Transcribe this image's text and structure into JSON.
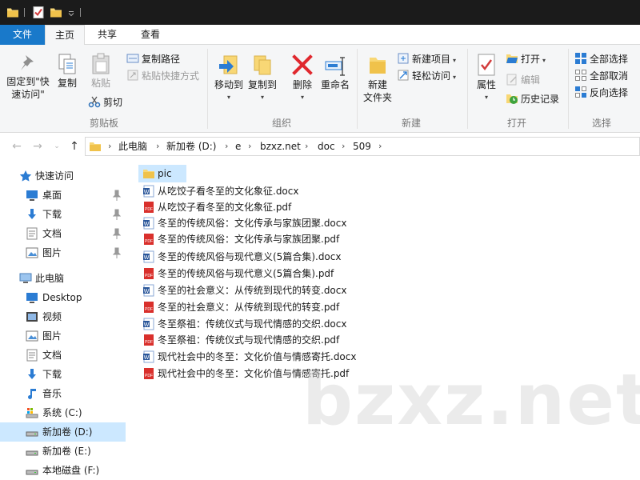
{
  "window": {
    "quick_access_icons": [
      "folder-icon",
      "properties-check-icon",
      "new-folder-icon",
      "customize-dropdown-icon"
    ]
  },
  "ribbon_tabs": {
    "file": "文件",
    "home": "主页",
    "share": "共享",
    "view": "查看"
  },
  "ribbon": {
    "clipboard": {
      "pin_label_1": "固定到\"快",
      "pin_label_2": "速访问\"",
      "copy": "复制",
      "paste": "粘贴",
      "copy_path": "复制路径",
      "paste_shortcut": "粘贴快捷方式",
      "cut": "剪切",
      "group_label": "剪贴板"
    },
    "organize": {
      "move_to": "移动到",
      "copy_to": "复制到",
      "delete": "删除",
      "rename": "重命名",
      "group_label": "组织"
    },
    "new": {
      "new_folder_1": "新建",
      "new_folder_2": "文件夹",
      "new_item": "新建项目",
      "easy_access": "轻松访问",
      "group_label": "新建"
    },
    "open": {
      "properties": "属性",
      "open": "打开",
      "edit": "编辑",
      "history": "历史记录",
      "group_label": "打开"
    },
    "select": {
      "select_all": "全部选择",
      "select_none": "全部取消",
      "invert": "反向选择",
      "group_label": "选择"
    }
  },
  "address": {
    "crumbs": [
      "此电脑",
      "新加卷 (D:)",
      "e",
      "bzxz.net",
      "doc",
      "509"
    ]
  },
  "nav_pane": {
    "quick_access": "快速访问",
    "desktop_pinned": "桌面",
    "downloads_pinned": "下载",
    "documents_pinned": "文档",
    "pictures_pinned": "图片",
    "this_pc": "此电脑",
    "desktop": "Desktop",
    "videos": "视频",
    "pictures": "图片",
    "documents": "文档",
    "downloads": "下载",
    "music": "音乐",
    "drive_c": "系统 (C:)",
    "drive_d": "新加卷 (D:)",
    "drive_e": "新加卷 (E:)",
    "drive_f": "本地磁盘 (F:)"
  },
  "files": [
    {
      "name": "pic",
      "type": "folder"
    },
    {
      "name": "从吃饺子看冬至的文化象征.docx",
      "type": "docx"
    },
    {
      "name": "从吃饺子看冬至的文化象征.pdf",
      "type": "pdf"
    },
    {
      "name": "冬至的传统风俗：文化传承与家族团聚.docx",
      "type": "docx"
    },
    {
      "name": "冬至的传统风俗：文化传承与家族团聚.pdf",
      "type": "pdf"
    },
    {
      "name": "冬至的传统风俗与现代意义(5篇合集).docx",
      "type": "docx"
    },
    {
      "name": "冬至的传统风俗与现代意义(5篇合集).pdf",
      "type": "pdf"
    },
    {
      "name": "冬至的社会意义：从传统到现代的转变.docx",
      "type": "docx"
    },
    {
      "name": "冬至的社会意义：从传统到现代的转变.pdf",
      "type": "pdf"
    },
    {
      "name": "冬至祭祖：传统仪式与现代情感的交织.docx",
      "type": "docx"
    },
    {
      "name": "冬至祭祖：传统仪式与现代情感的交织.pdf",
      "type": "pdf"
    },
    {
      "name": "现代社会中的冬至：文化价值与情感寄托.docx",
      "type": "docx"
    },
    {
      "name": "现代社会中的冬至：文化价值与情感寄托.pdf",
      "type": "pdf"
    }
  ],
  "watermark": "bzxz.net",
  "colors": {
    "accent": "#1979ca",
    "selection": "#cce8ff",
    "folder": "#f8d775",
    "word": "#2b579a",
    "pdf": "#d9302c",
    "delete": "#e0282e"
  }
}
